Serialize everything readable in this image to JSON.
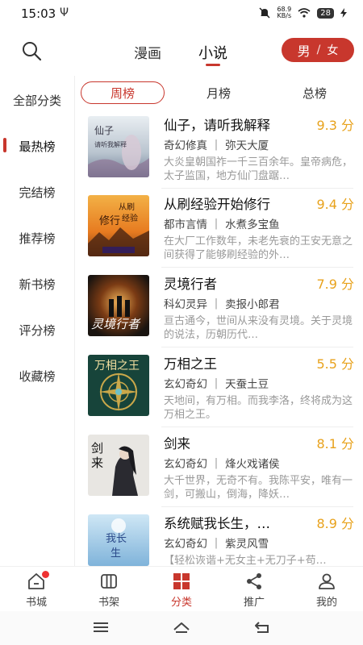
{
  "status": {
    "time": "15:03",
    "usb": "Ψ",
    "speed_value": "68.9",
    "speed_unit": "KB/s",
    "battery": "28"
  },
  "header": {
    "tabs": [
      {
        "label": "漫画"
      },
      {
        "label": "小说"
      }
    ],
    "gender": {
      "male": "男",
      "sep": "/",
      "female": "女"
    }
  },
  "sidebar": {
    "items": [
      {
        "label": "全部分类"
      },
      {
        "label": "最热榜"
      },
      {
        "label": "完结榜"
      },
      {
        "label": "推荐榜"
      },
      {
        "label": "新书榜"
      },
      {
        "label": "评分榜"
      },
      {
        "label": "收藏榜"
      }
    ],
    "active_index": 1
  },
  "rank_tabs": [
    {
      "label": "周榜"
    },
    {
      "label": "月榜"
    },
    {
      "label": "总榜"
    }
  ],
  "books": [
    {
      "title": "仙子，请听我解释",
      "score": "9.3 分",
      "genre": "奇幻修真",
      "author": "弥天大厦",
      "desc": "大炎皇朝国祚一千三百余年。皇帝病危，太子监国，地方仙门盘踞…",
      "cover_text": "仙子 请听我解释"
    },
    {
      "title": "从刷经验开始修行",
      "score": "9.4 分",
      "genre": "都市言情",
      "author": "水煮多宝鱼",
      "desc": "在大厂工作数年，未老先衰的王安无意之间获得了能够刷经验的外…",
      "cover_text": "从刷经验开始修行"
    },
    {
      "title": "灵境行者",
      "score": "7.9 分",
      "genre": "科幻灵异",
      "author": "卖报小郎君",
      "desc": "亘古通今，世间从来没有灵境。关于灵境的说法，历朝历代…",
      "cover_text": "灵境行者"
    },
    {
      "title": "万相之王",
      "score": "5.5 分",
      "genre": "玄幻奇幻",
      "author": "天蚕土豆",
      "desc": "天地间，有万相。而我李洛，终将成为这万相之王。",
      "cover_text": "万相之王"
    },
    {
      "title": "剑来",
      "score": "8.1 分",
      "genre": "玄幻奇幻",
      "author": "烽火戏诸侯",
      "desc": "大千世界，无奇不有。我陈平安，唯有一剑，可搬山，倒海，降妖…",
      "cover_text": "剑来"
    },
    {
      "title": "系统赋我长生，…",
      "score": "8.9 分",
      "genre": "玄幻奇幻",
      "author": "紫灵风雪",
      "desc": "【轻松诙谐+无女主+无刀子+苟…",
      "cover_text": "我长生"
    }
  ],
  "bottom_nav": [
    {
      "label": "书城",
      "icon": "home-icon"
    },
    {
      "label": "书架",
      "icon": "bookshelf-icon"
    },
    {
      "label": "分类",
      "icon": "category-icon"
    },
    {
      "label": "推广",
      "icon": "share-icon"
    },
    {
      "label": "我的",
      "icon": "profile-icon"
    }
  ],
  "colors": {
    "accent": "#c8372d",
    "score": "#e8a21c",
    "muted": "#999999"
  }
}
